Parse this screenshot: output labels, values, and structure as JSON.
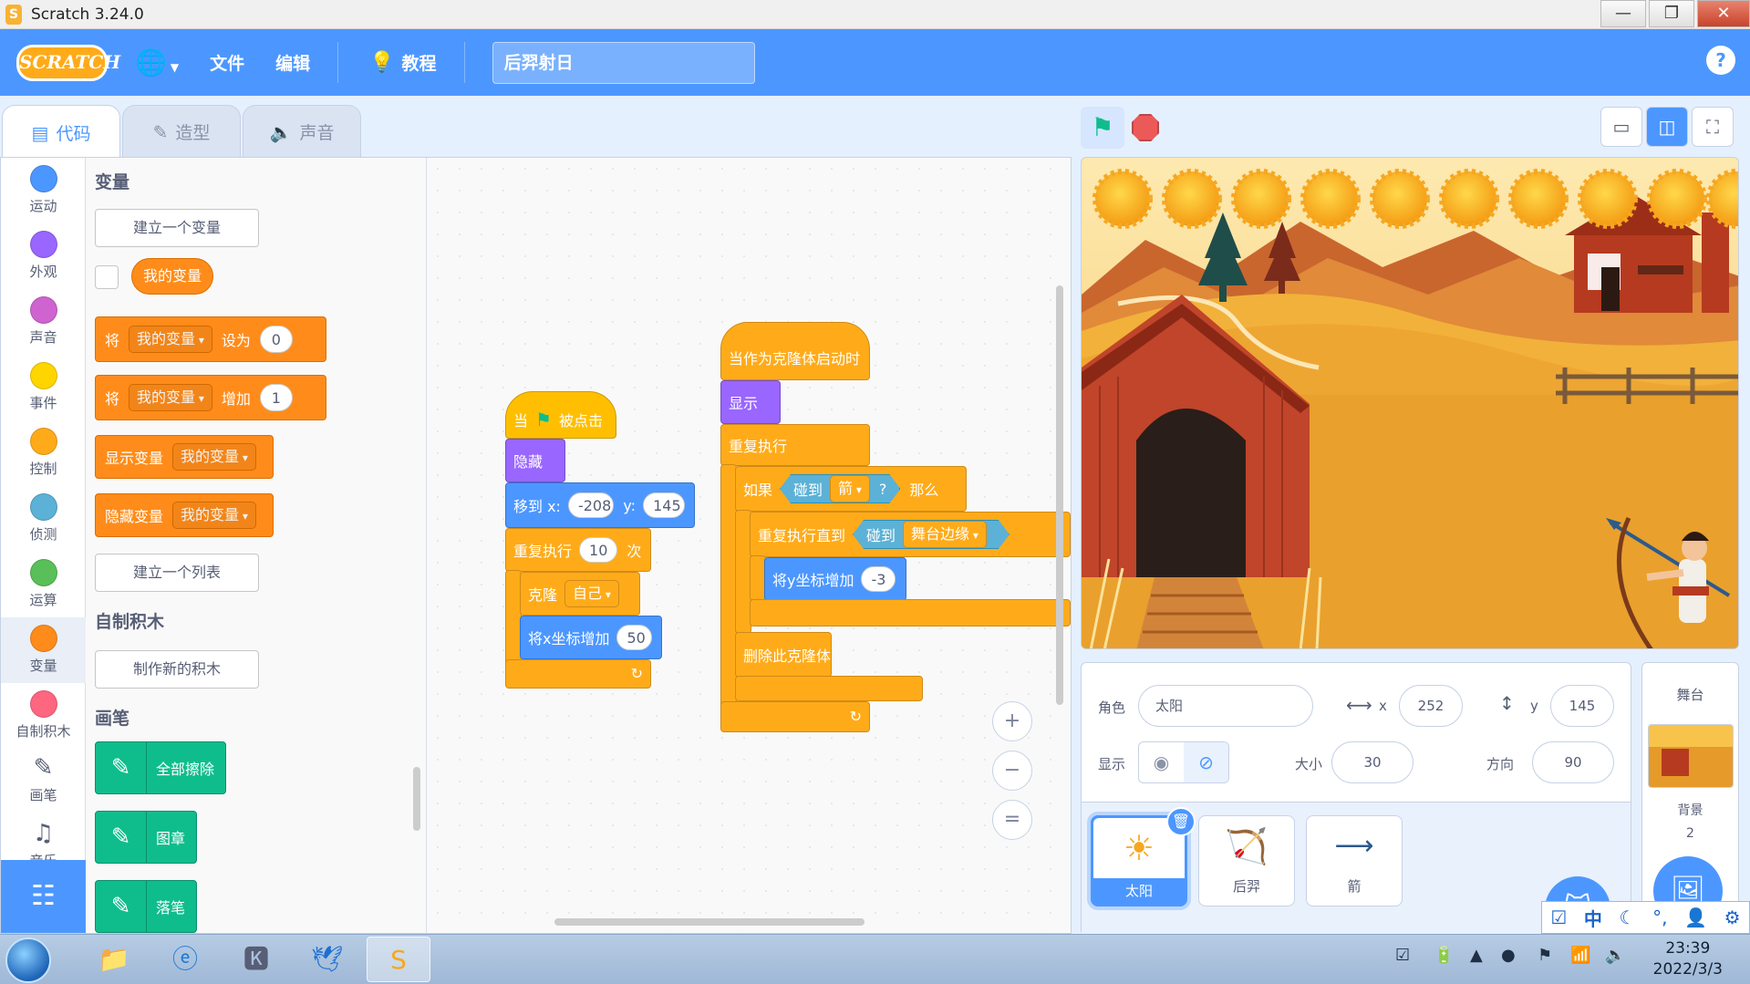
{
  "window": {
    "title": "Scratch 3.24.0",
    "minimize": "—",
    "restore": "❐",
    "close": "✕"
  },
  "menubar": {
    "logo": "SCRATCH",
    "file": "文件",
    "edit": "编辑",
    "tutorials": "教程",
    "project_title": "后羿射日",
    "help": "?"
  },
  "tabs": [
    {
      "label": "代码",
      "icon": "code-icon"
    },
    {
      "label": "造型",
      "icon": "brush-icon"
    },
    {
      "label": "声音",
      "icon": "speaker-icon"
    }
  ],
  "categories": [
    {
      "label": "运动",
      "color": "#4c97ff"
    },
    {
      "label": "外观",
      "color": "#9966ff"
    },
    {
      "label": "声音",
      "color": "#cf63cf"
    },
    {
      "label": "事件",
      "color": "#ffd500"
    },
    {
      "label": "控制",
      "color": "#ffab19"
    },
    {
      "label": "侦测",
      "color": "#5cb1d6"
    },
    {
      "label": "运算",
      "color": "#59c059"
    },
    {
      "label": "变量",
      "color": "#ff8c1a"
    },
    {
      "label": "自制积木",
      "color": "#ff6680"
    },
    {
      "label": "画笔",
      "color": ""
    },
    {
      "label": "音乐",
      "color": ""
    }
  ],
  "palette": {
    "variables_heading": "变量",
    "make_variable": "建立一个变量",
    "my_variable": "我的变量",
    "set_block": {
      "prefix": "将",
      "var": "我的变量",
      "mid": "设为",
      "value": "0"
    },
    "change_block": {
      "prefix": "将",
      "var": "我的变量",
      "mid": "增加",
      "value": "1"
    },
    "show_var_block": {
      "label": "显示变量",
      "var": "我的变量"
    },
    "hide_var_block": {
      "label": "隐藏变量",
      "var": "我的变量"
    },
    "make_list": "建立一个列表",
    "myblocks_heading": "自制积木",
    "make_block": "制作新的积木",
    "pen_heading": "画笔",
    "pen_clear": "全部擦除",
    "pen_stamp": "图章",
    "pen_down": "落笔"
  },
  "script1": {
    "when": "当",
    "clicked": "被点击",
    "hide": "隐藏",
    "goto_label": "移到 x:",
    "goto_x": "-208",
    "goto_y_label": "y:",
    "goto_y": "145",
    "repeat_label": "重复执行",
    "repeat_count": "10",
    "repeat_times": "次",
    "clone_label": "克隆",
    "clone_target": "自己",
    "change_x_label": "将x坐标增加",
    "change_x_value": "50"
  },
  "script2": {
    "hat": "当作为克隆体启动时",
    "show": "显示",
    "forever": "重复执行",
    "if": "如果",
    "touching": "碰到",
    "touching_target": "箭",
    "question": "?",
    "then": "那么",
    "repeat_until": "重复执行直到",
    "touching2": "碰到",
    "edge": "舞台边缘",
    "change_y_label": "将y坐标增加",
    "change_y_value": "-3",
    "delete_clone": "删除此克隆体"
  },
  "zoom": {
    "in": "+",
    "out": "−",
    "reset": "="
  },
  "sprite_info": {
    "sprite_label": "角色",
    "sprite_name": "太阳",
    "x_label": "x",
    "x_value": "252",
    "y_label": "y",
    "y_value": "145",
    "show_label": "显示",
    "size_label": "大小",
    "size_value": "30",
    "direction_label": "方向",
    "direction_value": "90"
  },
  "sprites": [
    {
      "name": "太阳",
      "icon": "sun-icon",
      "selected": true
    },
    {
      "name": "后羿",
      "icon": "archer-icon",
      "selected": false
    },
    {
      "name": "箭",
      "icon": "arrow-icon",
      "selected": false
    }
  ],
  "stage_pane": {
    "heading": "舞台",
    "backdrop_label": "背景",
    "backdrop_count": "2"
  },
  "ime": {
    "lang": "中"
  },
  "clock": {
    "time": "23:39",
    "date": "2022/3/3"
  },
  "colors": {
    "accent": "#4c97ff",
    "variables": "#ff8c1a",
    "control": "#ffab19",
    "events": "#ffbf00",
    "looks": "#9966ff",
    "sensing": "#5cb1d6",
    "pen": "#0fbd8c"
  }
}
